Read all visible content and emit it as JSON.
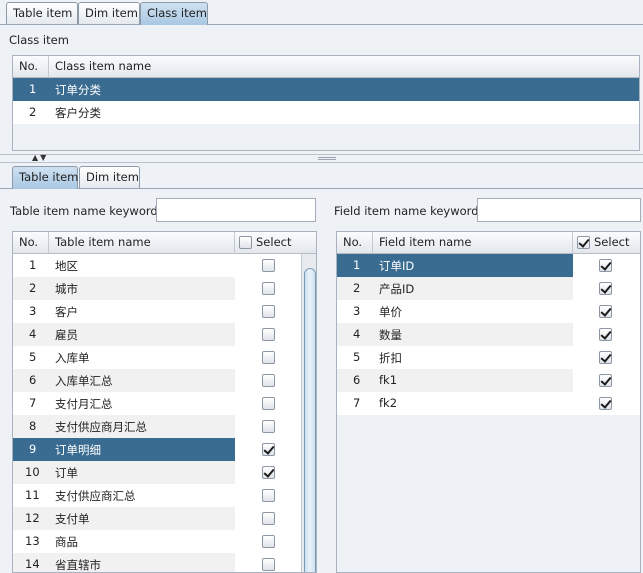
{
  "top_tabs": [
    "Table item",
    "Dim item",
    "Class item"
  ],
  "class_section": {
    "title": "Class item",
    "columns": [
      "No.",
      "Class item name"
    ],
    "rows": [
      {
        "no": "1",
        "name": "订单分类",
        "selected": true
      },
      {
        "no": "2",
        "name": "客户分类",
        "selected": false
      }
    ]
  },
  "bottom_tabs": [
    "Table item",
    "Dim item"
  ],
  "table_search": {
    "label": "Table item name keyword",
    "value": ""
  },
  "field_search": {
    "label": "Field item name keyword",
    "value": ""
  },
  "table_list": {
    "columns": [
      "No.",
      "Table item name",
      "Select"
    ],
    "header_checked": false,
    "rows": [
      {
        "no": "1",
        "name": "地区",
        "checked": false,
        "selected": false
      },
      {
        "no": "2",
        "name": "城市",
        "checked": false,
        "selected": false
      },
      {
        "no": "3",
        "name": "客户",
        "checked": false,
        "selected": false
      },
      {
        "no": "4",
        "name": "雇员",
        "checked": false,
        "selected": false
      },
      {
        "no": "5",
        "name": "入库单",
        "checked": false,
        "selected": false
      },
      {
        "no": "6",
        "name": "入库单汇总",
        "checked": false,
        "selected": false
      },
      {
        "no": "7",
        "name": "支付月汇总",
        "checked": false,
        "selected": false
      },
      {
        "no": "8",
        "name": "支付供应商月汇总",
        "checked": false,
        "selected": false
      },
      {
        "no": "9",
        "name": "订单明细",
        "checked": true,
        "selected": true
      },
      {
        "no": "10",
        "name": "订单",
        "checked": true,
        "selected": false
      },
      {
        "no": "11",
        "name": "支付供应商汇总",
        "checked": false,
        "selected": false
      },
      {
        "no": "12",
        "name": "支付单",
        "checked": false,
        "selected": false
      },
      {
        "no": "13",
        "name": "商品",
        "checked": false,
        "selected": false
      },
      {
        "no": "14",
        "name": "省直辖市",
        "checked": false,
        "selected": false
      }
    ]
  },
  "field_list": {
    "columns": [
      "No.",
      "Field item name",
      "Select"
    ],
    "header_checked": true,
    "rows": [
      {
        "no": "1",
        "name": "订单ID",
        "checked": true,
        "selected": true
      },
      {
        "no": "2",
        "name": "产品ID",
        "checked": true,
        "selected": false
      },
      {
        "no": "3",
        "name": "单价",
        "checked": true,
        "selected": false
      },
      {
        "no": "4",
        "name": "数量",
        "checked": true,
        "selected": false
      },
      {
        "no": "5",
        "name": "折扣",
        "checked": true,
        "selected": false
      },
      {
        "no": "6",
        "name": "fk1",
        "checked": true,
        "selected": false
      },
      {
        "no": "7",
        "name": "fk2",
        "checked": true,
        "selected": false
      }
    ]
  },
  "colors": {
    "selection": "#3a6b91",
    "alt_row": "#f1f1f1",
    "active_tab": "#b9d3ea"
  }
}
